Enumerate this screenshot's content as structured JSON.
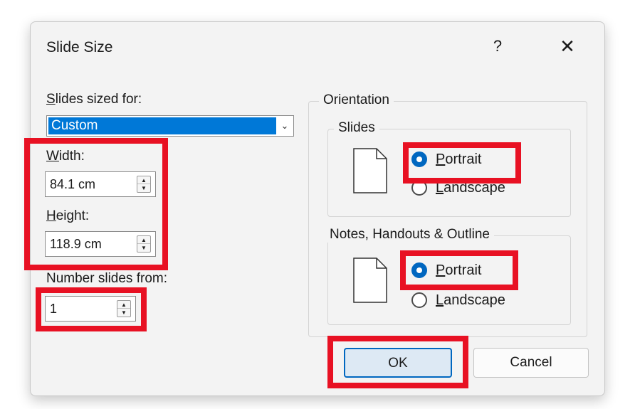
{
  "dialog": {
    "title": "Slide Size",
    "help_label": "?",
    "close_label": "✕"
  },
  "left": {
    "slides_sized_for": {
      "first": "S",
      "rest": "lides sized for:"
    },
    "sized_for_value": "Custom",
    "width": {
      "first": "W",
      "rest": "idth:",
      "value": "84.1 cm"
    },
    "height": {
      "first": "H",
      "rest": "eight:",
      "value": "118.9 cm"
    },
    "number_slides_from": {
      "label": "Number slides from:",
      "value": "1"
    }
  },
  "orientation": {
    "legend": "Orientation",
    "slides": {
      "legend": "Slides",
      "portrait": {
        "first": "P",
        "rest": "ortrait",
        "checked": true
      },
      "landscape": {
        "first": "L",
        "rest": "andscape",
        "checked": false
      }
    },
    "notes": {
      "legend": "Notes, Handouts & Outline",
      "portrait": {
        "first": "P",
        "rest": "ortrait",
        "checked": true
      },
      "landscape": {
        "first": "L",
        "rest": "andscape",
        "checked": false
      }
    }
  },
  "buttons": {
    "ok": "OK",
    "cancel": "Cancel"
  },
  "colors": {
    "highlight": "#e81123",
    "accent": "#0067c0",
    "selection": "#0078d7"
  },
  "icons": [
    "question-mark-icon",
    "close-icon",
    "chevron-down-icon",
    "spin-up-icon",
    "spin-down-icon",
    "page-portrait-icon"
  ]
}
